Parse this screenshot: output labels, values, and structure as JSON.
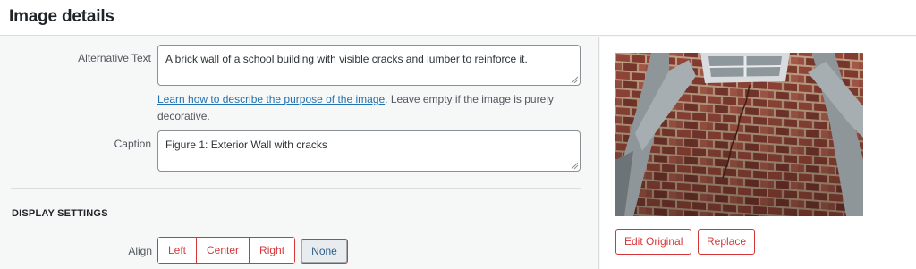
{
  "header": {
    "title": "Image details"
  },
  "form": {
    "alt_text": {
      "label": "Alternative Text",
      "value": "A brick wall of a school building with visible cracks and lumber to reinforce it.",
      "help_link": "Learn how to describe the purpose of the image",
      "help_text": ". Leave empty if the image is purely decorative."
    },
    "caption": {
      "label": "Caption",
      "value": "Figure 1: Exterior Wall with cracks"
    },
    "display_settings": {
      "title": "DISPLAY SETTINGS",
      "align_label": "Align",
      "options": [
        "Left",
        "Center",
        "Right",
        "None"
      ],
      "selected": "None"
    }
  },
  "preview": {
    "image_alt": "A brick wall of a school building with visible cracks and lumber to reinforce it.",
    "edit_original": "Edit Original",
    "replace": "Replace"
  },
  "colors": {
    "accent": "#d63638",
    "link": "#2271b1",
    "panel_bg": "#f6f7f7"
  }
}
